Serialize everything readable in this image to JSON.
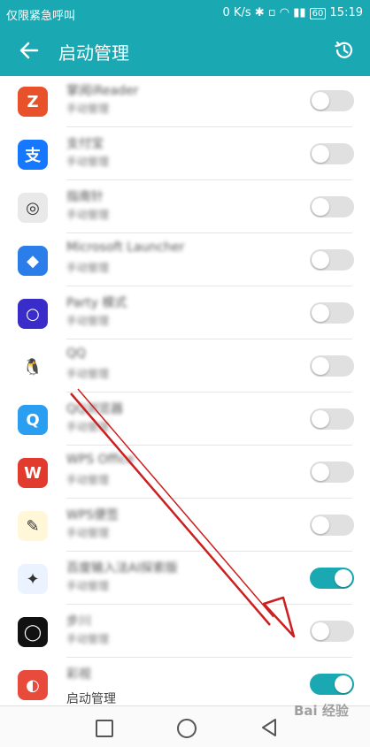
{
  "status_bar": {
    "left_text": "仅限紧急呼叫",
    "speed": "0 K/s",
    "battery": "60",
    "time": "15:19"
  },
  "header": {
    "title": "启动管理"
  },
  "apps": [
    {
      "name": "掌阅iReader",
      "sub": "手动管理",
      "on": false,
      "icon_color": "#e8512a",
      "icon_glyph": "Z"
    },
    {
      "name": "支付宝",
      "sub": "手动管理",
      "on": false,
      "icon_color": "#1677ff",
      "icon_glyph": "支"
    },
    {
      "name": "指南针",
      "sub": "手动管理",
      "on": false,
      "icon_color": "#e9e9e9",
      "icon_glyph": "◎"
    },
    {
      "name": "Microsoft Launcher",
      "sub": "手动管理",
      "on": false,
      "icon_color": "#2b7de9",
      "icon_glyph": "◆"
    },
    {
      "name": "Party 模式",
      "sub": "手动管理",
      "on": false,
      "icon_color": "#3a2cc9",
      "icon_glyph": "○"
    },
    {
      "name": "QQ",
      "sub": "手动管理",
      "on": false,
      "icon_color": "#ffffff",
      "icon_glyph": "🐧"
    },
    {
      "name": "QQ浏览器",
      "sub": "手动管理",
      "on": false,
      "icon_color": "#2a9ef0",
      "icon_glyph": "Q"
    },
    {
      "name": "WPS Office",
      "sub": "手动管理",
      "on": false,
      "icon_color": "#e23b2e",
      "icon_glyph": "W"
    },
    {
      "name": "WPS便签",
      "sub": "手动管理",
      "on": false,
      "icon_color": "#fff7d8",
      "icon_glyph": "✎"
    },
    {
      "name": "百度输入法AI探索版",
      "sub": "手动管理",
      "on": true,
      "icon_color": "#eaf3ff",
      "icon_glyph": "✦"
    },
    {
      "name": "步川",
      "sub": "手动管理",
      "on": false,
      "icon_color": "#111111",
      "icon_glyph": "◯"
    },
    {
      "name": "彩视",
      "sub": "启动管理",
      "on": true,
      "icon_color": "#e84a3c",
      "icon_glyph": "◐"
    }
  ],
  "watermark": "Bai 经验",
  "colors": {
    "accent": "#1aa9b3",
    "arrow": "#cc1f1f"
  }
}
